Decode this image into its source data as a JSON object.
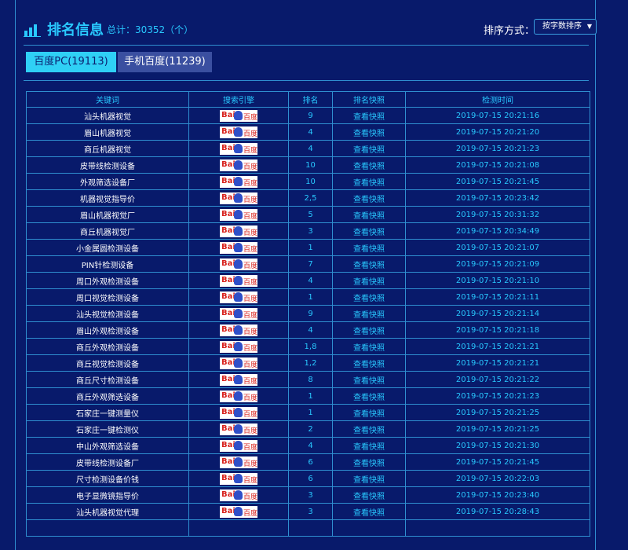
{
  "header": {
    "title": "排名信息",
    "total": "总计：30352（个）",
    "sort_label": "排序方式：",
    "sort_value": "按字数排序",
    "sort_arrow": "▼"
  },
  "tabs": [
    {
      "label": "百度PC(19113)",
      "active": true
    },
    {
      "label": "手机百度(11239)",
      "active": false
    }
  ],
  "table": {
    "columns": [
      "关键词",
      "搜索引擎",
      "排名",
      "排名快照",
      "检测时间"
    ],
    "engine_logo_text": {
      "bai": "Bai",
      "du": "百度"
    },
    "rows": [
      {
        "keyword": "汕头机器视觉",
        "rank": "9",
        "snapshot": "查看快照",
        "time": "2019-07-15 20:21:16"
      },
      {
        "keyword": "眉山机器视觉",
        "rank": "4",
        "snapshot": "查看快照",
        "time": "2019-07-15 20:21:20"
      },
      {
        "keyword": "商丘机器视觉",
        "rank": "4",
        "snapshot": "查看快照",
        "time": "2019-07-15 20:21:23"
      },
      {
        "keyword": "皮带线检测设备",
        "rank": "10",
        "snapshot": "查看快照",
        "time": "2019-07-15 20:21:08"
      },
      {
        "keyword": "外观筛选设备厂",
        "rank": "10",
        "snapshot": "查看快照",
        "time": "2019-07-15 20:21:45"
      },
      {
        "keyword": "机器视觉指导价",
        "rank": "2,5",
        "snapshot": "查看快照",
        "time": "2019-07-15 20:23:42"
      },
      {
        "keyword": "眉山机器视觉厂",
        "rank": "5",
        "snapshot": "查看快照",
        "time": "2019-07-15 20:31:32"
      },
      {
        "keyword": "商丘机器视觉厂",
        "rank": "3",
        "snapshot": "查看快照",
        "time": "2019-07-15 20:34:49"
      },
      {
        "keyword": "小金属圆检测设备",
        "rank": "1",
        "snapshot": "查看快照",
        "time": "2019-07-15 20:21:07"
      },
      {
        "keyword": "PIN针检测设备",
        "rank": "7",
        "snapshot": "查看快照",
        "time": "2019-07-15 20:21:09"
      },
      {
        "keyword": "周口外观检测设备",
        "rank": "4",
        "snapshot": "查看快照",
        "time": "2019-07-15 20:21:10"
      },
      {
        "keyword": "周口视觉检测设备",
        "rank": "1",
        "snapshot": "查看快照",
        "time": "2019-07-15 20:21:11"
      },
      {
        "keyword": "汕头视觉检测设备",
        "rank": "9",
        "snapshot": "查看快照",
        "time": "2019-07-15 20:21:14"
      },
      {
        "keyword": "眉山外观检测设备",
        "rank": "4",
        "snapshot": "查看快照",
        "time": "2019-07-15 20:21:18"
      },
      {
        "keyword": "商丘外观检测设备",
        "rank": "1,8",
        "snapshot": "查看快照",
        "time": "2019-07-15 20:21:21"
      },
      {
        "keyword": "商丘视觉检测设备",
        "rank": "1,2",
        "snapshot": "查看快照",
        "time": "2019-07-15 20:21:21"
      },
      {
        "keyword": "商丘尺寸检测设备",
        "rank": "8",
        "snapshot": "查看快照",
        "time": "2019-07-15 20:21:22"
      },
      {
        "keyword": "商丘外观筛选设备",
        "rank": "1",
        "snapshot": "查看快照",
        "time": "2019-07-15 20:21:23"
      },
      {
        "keyword": "石家庄一键测量仪",
        "rank": "1",
        "snapshot": "查看快照",
        "time": "2019-07-15 20:21:25"
      },
      {
        "keyword": "石家庄一键检测仪",
        "rank": "2",
        "snapshot": "查看快照",
        "time": "2019-07-15 20:21:25"
      },
      {
        "keyword": "中山外观筛选设备",
        "rank": "4",
        "snapshot": "查看快照",
        "time": "2019-07-15 20:21:30"
      },
      {
        "keyword": "皮带线检测设备厂",
        "rank": "6",
        "snapshot": "查看快照",
        "time": "2019-07-15 20:21:45"
      },
      {
        "keyword": "尺寸检测设备价钱",
        "rank": "6",
        "snapshot": "查看快照",
        "time": "2019-07-15 20:22:03"
      },
      {
        "keyword": "电子显微镜指导价",
        "rank": "3",
        "snapshot": "查看快照",
        "time": "2019-07-15 20:23:40"
      },
      {
        "keyword": "汕头机器视觉代理",
        "rank": "3",
        "snapshot": "查看快照",
        "time": "2019-07-15 20:28:43"
      },
      {
        "keyword": "",
        "rank": "",
        "snapshot": "",
        "time": ""
      }
    ]
  },
  "colors": {
    "background": "#081a6b",
    "accent": "#29c9ff",
    "active_tab": "#2fd0f5",
    "inactive_tab": "#3a4fa0",
    "border": "#2f8fd0"
  },
  "icons": {
    "header_icon": "bar-chart-icon",
    "engine_icon": "baidu-logo-icon",
    "dropdown_icon": "caret-down-icon"
  }
}
